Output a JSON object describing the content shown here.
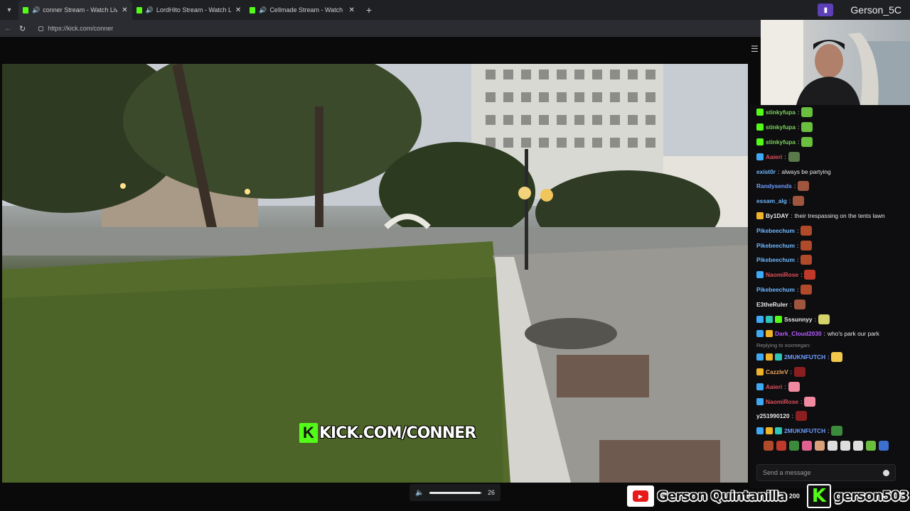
{
  "browser": {
    "tabs": [
      {
        "title": "conner Stream - Watch Live o",
        "active": true,
        "audio": true
      },
      {
        "title": "LordHito Stream - Watch Live",
        "active": false,
        "audio": true
      },
      {
        "title": "Cellmade Stream - Watch Live",
        "active": false,
        "audio": true
      }
    ],
    "url": "https://kick.com/conner",
    "profile_name": "Gerson_5C"
  },
  "video": {
    "watermark": "KICK.COM/CONNER",
    "volume_value": "26",
    "volume_level": 0.97
  },
  "chat": {
    "messages": [
      {
        "user": "stinkyfupa",
        "color": "#7ad35a",
        "text": "",
        "badges": [
          "#53fc18"
        ],
        "emotes": [
          "#6bbf3f"
        ]
      },
      {
        "user": "stinkyfupa",
        "color": "#7ad35a",
        "text": "",
        "badges": [
          "#53fc18"
        ],
        "emotes": [
          "#6bbf3f"
        ]
      },
      {
        "user": "stinkyfupa",
        "color": "#7ad35a",
        "text": "",
        "badges": [
          "#53fc18"
        ],
        "emotes": [
          "#6bbf3f"
        ]
      },
      {
        "user": "Aaieri",
        "color": "#e0505a",
        "text": "",
        "badges": [
          "#3fa9f5"
        ],
        "emotes": [
          "#5a7a4a"
        ]
      },
      {
        "user": "exist0r",
        "color": "#6fb7ff",
        "text": "always be partying",
        "badges": [],
        "emotes": []
      },
      {
        "user": "Randysends",
        "color": "#6f9dff",
        "text": "",
        "badges": [],
        "emotes": [
          "#a0553e"
        ]
      },
      {
        "user": "essam_alg",
        "color": "#6fb7ff",
        "text": "",
        "badges": [],
        "emotes": [
          "#a0553e"
        ]
      },
      {
        "user": "By1DAY",
        "color": "#e8e8e8",
        "text": "their trespassing on the tents lawn",
        "badges": [
          "#f0b429"
        ],
        "emotes": []
      },
      {
        "user": "Pikebeechum",
        "color": "#6fb7ff",
        "text": "",
        "badges": [],
        "emotes": [
          "#b04a2a"
        ]
      },
      {
        "user": "Pikebeechum",
        "color": "#6fb7ff",
        "text": "",
        "badges": [],
        "emotes": [
          "#b04a2a"
        ]
      },
      {
        "user": "Pikebeechum",
        "color": "#6fb7ff",
        "text": "",
        "badges": [],
        "emotes": [
          "#b04a2a"
        ]
      },
      {
        "user": "NaomiRose",
        "color": "#e0505a",
        "text": "",
        "badges": [
          "#3fa9f5"
        ],
        "emotes": [
          "#c0392b"
        ]
      },
      {
        "user": "Pikebeechum",
        "color": "#6fb7ff",
        "text": "",
        "badges": [],
        "emotes": [
          "#b04a2a"
        ]
      },
      {
        "user": "E3theRuler",
        "color": "#e8e8e8",
        "text": "",
        "badges": [],
        "emotes": [
          "#a0553e"
        ]
      },
      {
        "user": "Sssunnyy",
        "color": "#e8e8e8",
        "text": "",
        "badges": [
          "#3fa9f5",
          "#2ec4b6",
          "#53fc18"
        ],
        "emotes": [
          "#d4d36a"
        ]
      },
      {
        "user": "Dark_Cloud2030",
        "color": "#b45cff",
        "text": "who's park our park",
        "badges": [
          "#3fa9f5",
          "#f0b429"
        ],
        "emotes": []
      },
      {
        "user": "2MUKNFUTCH",
        "color": "#6f9dff",
        "text": "",
        "badges": [
          "#3fa9f5",
          "#f0b429",
          "#2ec4b6"
        ],
        "emotes": [
          "#f2c94c"
        ]
      },
      {
        "user": "CazzleV",
        "color": "#f0a45a",
        "text": "",
        "badges": [
          "#f0b429"
        ],
        "emotes": [
          "#8b1e1e"
        ]
      },
      {
        "user": "Aaieri",
        "color": "#e0505a",
        "text": "",
        "badges": [
          "#3fa9f5"
        ],
        "emotes": [
          "#f08aa0"
        ]
      },
      {
        "user": "NaomiRose",
        "color": "#e0505a",
        "text": "",
        "badges": [
          "#3fa9f5"
        ],
        "emotes": [
          "#f08aa0"
        ]
      },
      {
        "user": "y251990120",
        "color": "#e8e8e8",
        "text": "",
        "badges": [],
        "emotes": [
          "#8b1e1e"
        ]
      },
      {
        "user": "2MUKNFUTCH",
        "color": "#6f9dff",
        "text": "",
        "badges": [
          "#3fa9f5",
          "#f0b429",
          "#2ec4b6"
        ],
        "emotes": [
          "#3c8a3c"
        ]
      }
    ],
    "reply_text": "Replying to xoxmegan:",
    "send_placeholder": "Send a message"
  },
  "socials": {
    "youtube_name": "Gerson Quintanilla",
    "viewer_count": "200",
    "kick_name": "gerson503"
  }
}
